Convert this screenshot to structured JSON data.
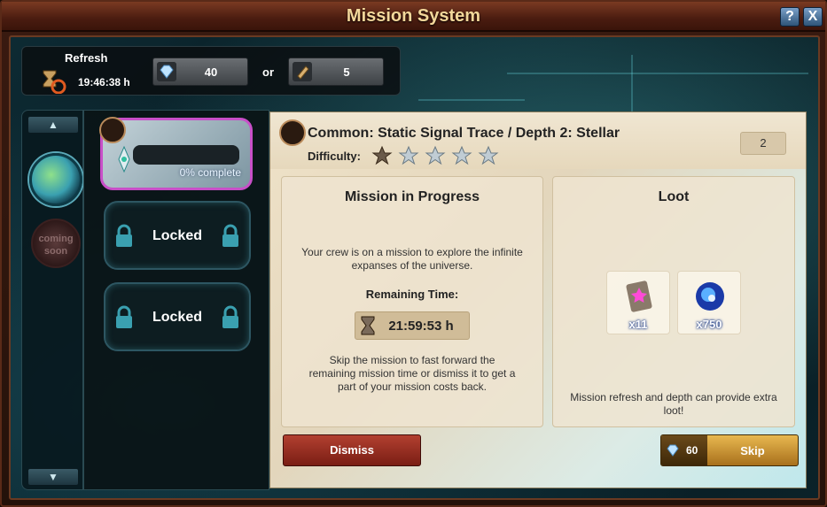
{
  "window": {
    "title": "Mission System",
    "help_label": "?",
    "close_label": "X"
  },
  "refresh": {
    "label": "Refresh",
    "time": "19:46:38 h",
    "gems_cost": "40",
    "or_label": "or",
    "scroll_cost": "5"
  },
  "sidebar": {
    "coming_soon_label": "coming soon"
  },
  "slots": {
    "active_progress": "0% complete",
    "locked_label_1": "Locked",
    "locked_label_2": "Locked"
  },
  "mission": {
    "title": "Common: Static Signal Trace / Depth 2: Stellar",
    "difficulty_label": "Difficulty:",
    "difficulty_stars": 1,
    "difficulty_max": 5,
    "level": "2"
  },
  "progress_panel": {
    "title": "Mission in Progress",
    "crew_text": "Your crew is on a mission to explore the infinite expanses of the universe.",
    "remaining_label": "Remaining Time:",
    "remaining_time": "21:59:53 h",
    "skip_text": "Skip the mission to fast forward the remaining mission time or dismiss it to get a part of your mission costs back."
  },
  "loot_panel": {
    "title": "Loot",
    "items": [
      {
        "icon": "star-card-icon",
        "qty": "x11"
      },
      {
        "icon": "nebula-icon",
        "qty": "x750"
      }
    ],
    "note": "Mission refresh and depth can provide extra loot!"
  },
  "actions": {
    "dismiss_label": "Dismiss",
    "skip_cost": "60",
    "skip_label": "Skip"
  },
  "colors": {
    "title_gold": "#f3d79a",
    "rarity_pink": "#c84fc8",
    "dismiss_red": "#b24030",
    "skip_gold": "#e8b850"
  }
}
